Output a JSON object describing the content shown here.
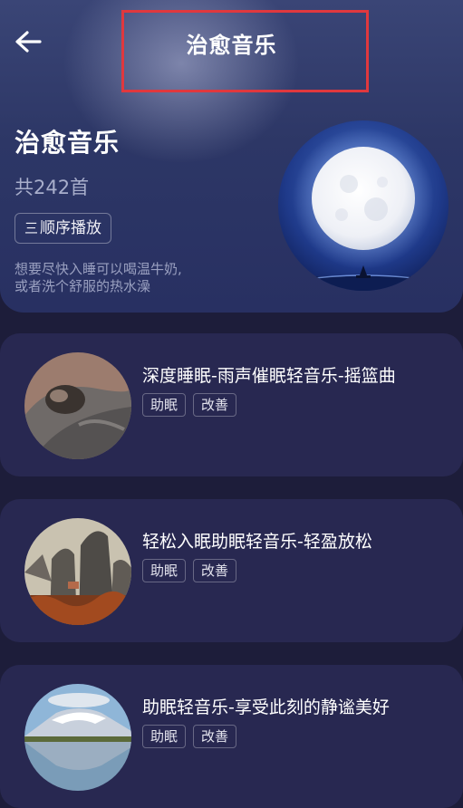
{
  "nav": {
    "title": "治愈音乐"
  },
  "playlist": {
    "title": "治愈音乐",
    "count": "共242首",
    "play_order_icon": "三",
    "play_order": "顺序播放",
    "desc_line1": "想要尽快入睡可以喝温牛奶,",
    "desc_line2": "或者洗个舒服的热水澡"
  },
  "songs": [
    {
      "title": "深度睡眠-雨声催眠轻音乐-摇篮曲",
      "tags": [
        "助眠",
        "改善"
      ],
      "thumb": "person-with-blanket"
    },
    {
      "title": "轻松入眠助眠轻音乐-轻盈放松",
      "tags": [
        "助眠",
        "改善"
      ],
      "thumb": "rock-pillars-landscape"
    },
    {
      "title": "助眠轻音乐-享受此刻的静谧美好",
      "tags": [
        "助眠",
        "改善"
      ],
      "thumb": "snow-mountain-lake"
    }
  ],
  "icons": {
    "back": "arrow-left-icon",
    "order": "list-order-icon"
  },
  "colors": {
    "background": "#1d1d3a",
    "card": "#282851",
    "header": "#2d3766",
    "highlight": "#e0383e"
  }
}
